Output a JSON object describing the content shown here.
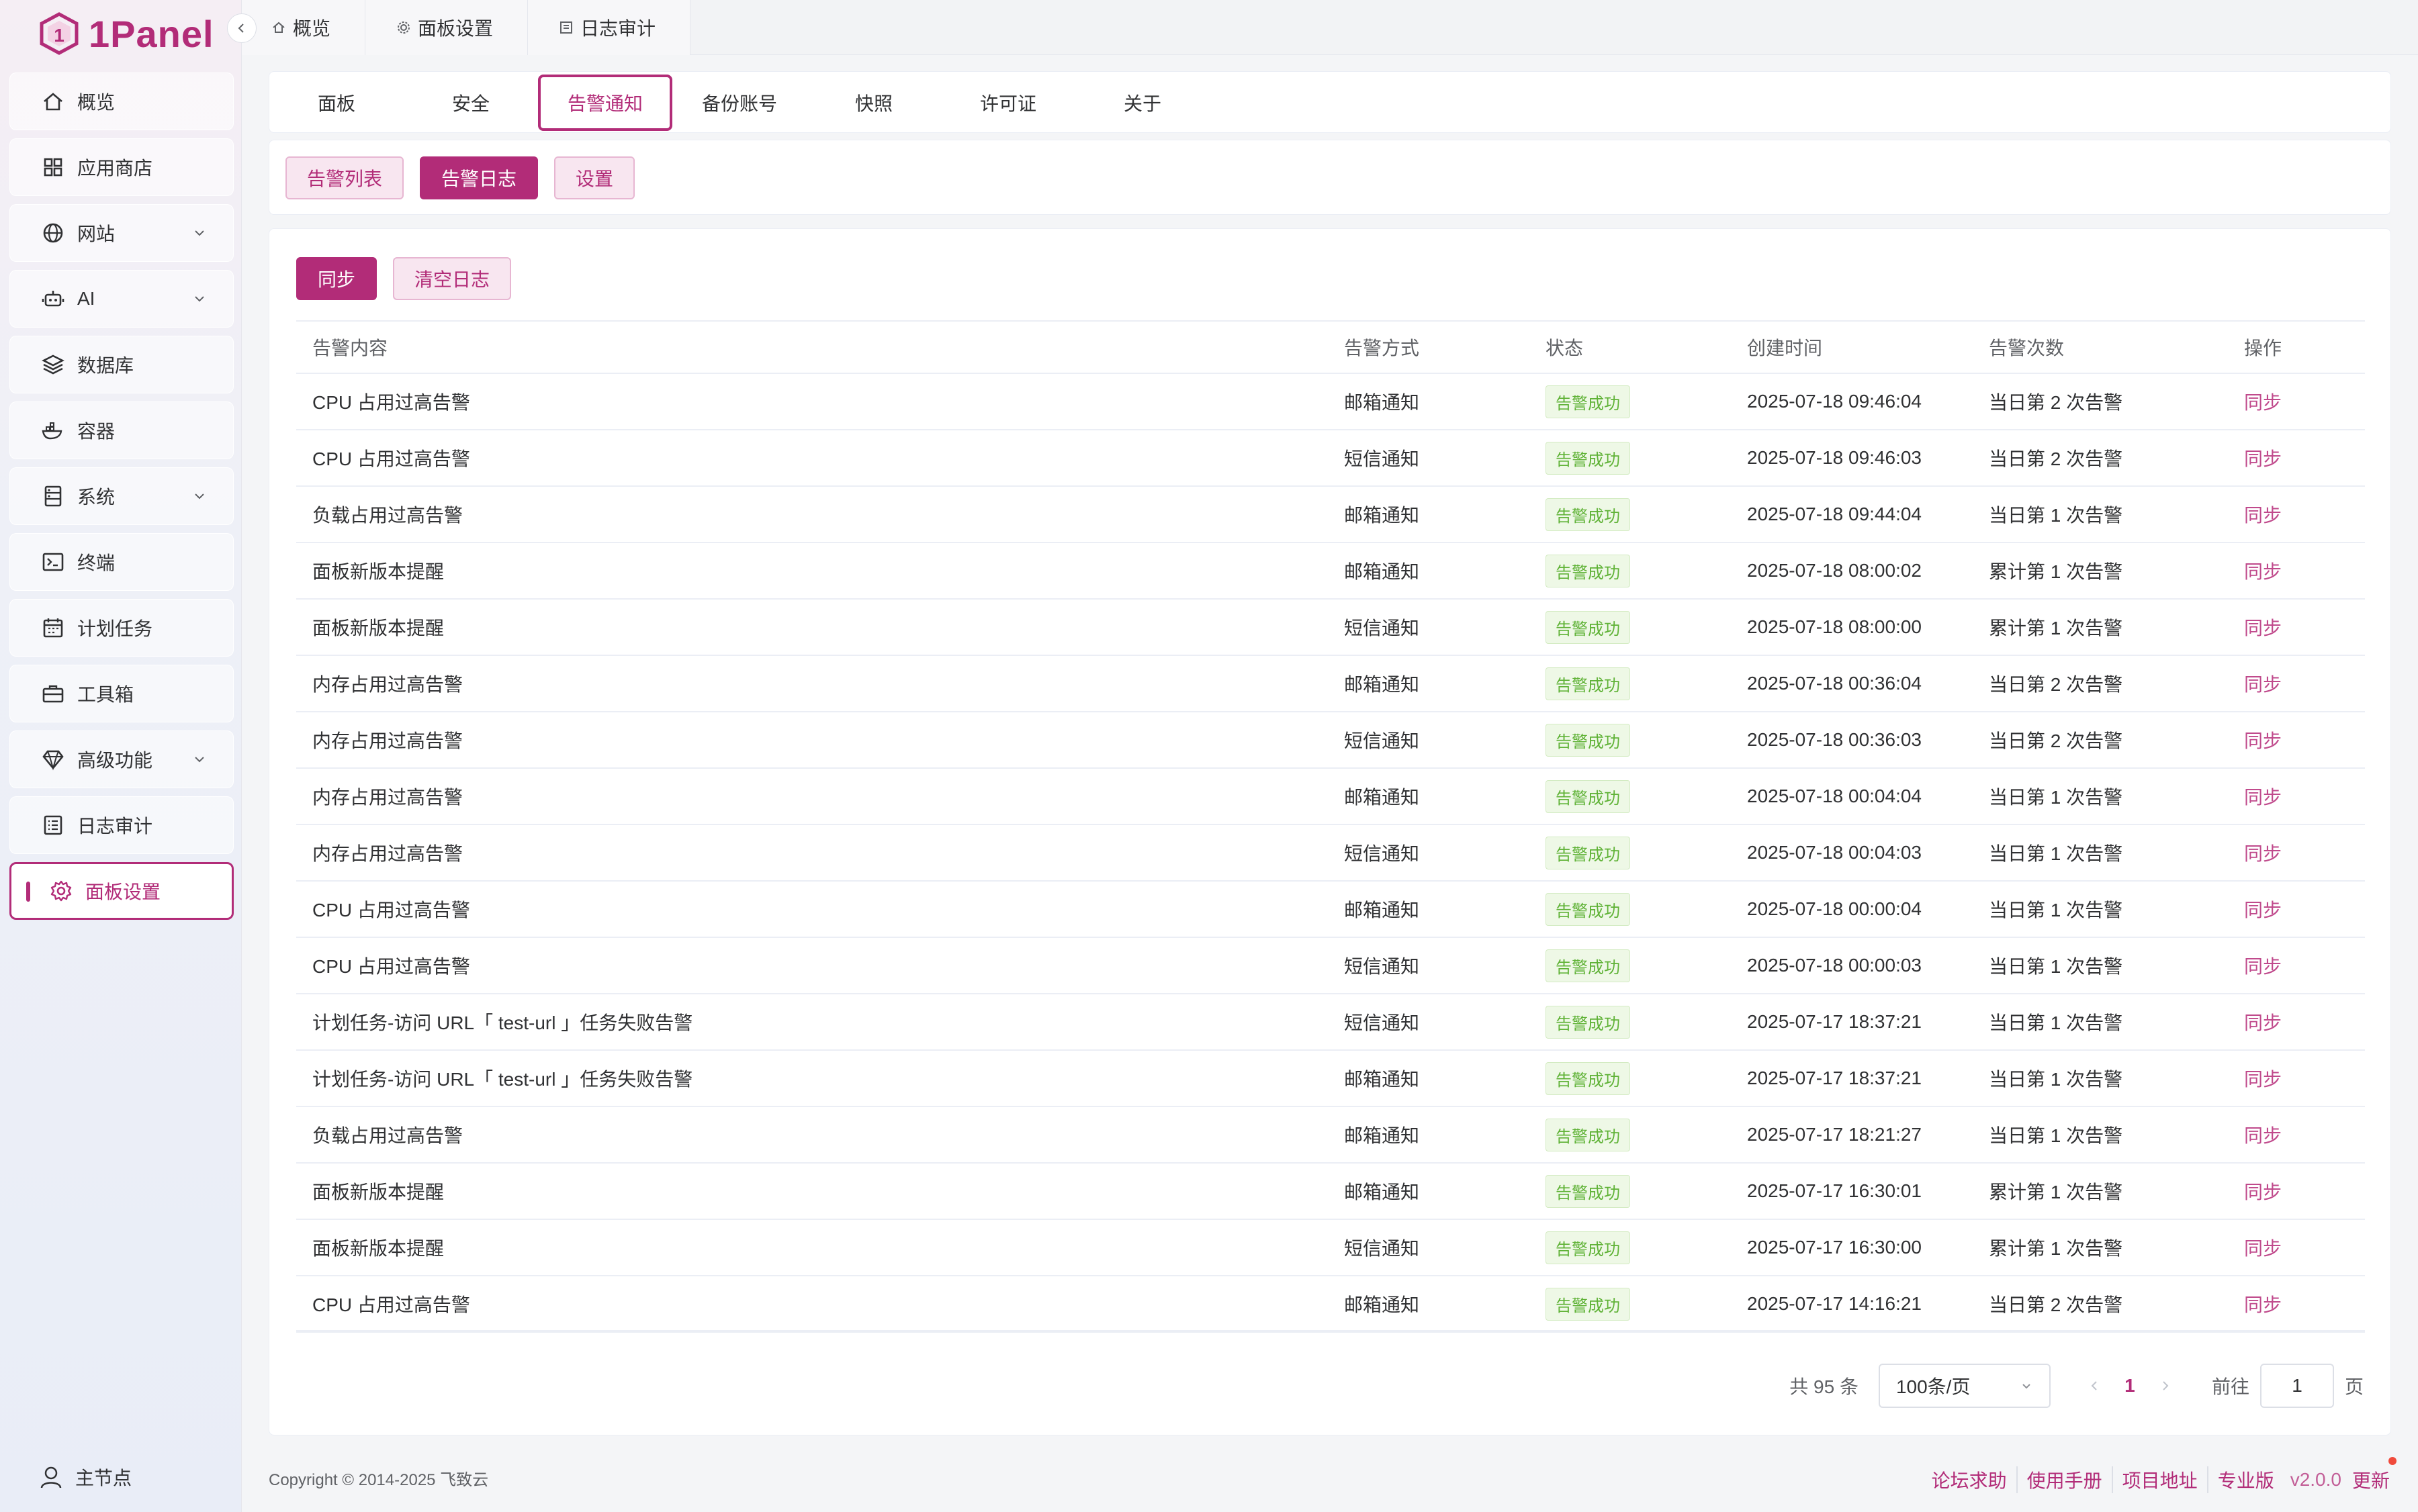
{
  "app": {
    "logo_text": "1Panel",
    "accent": "#b22c78"
  },
  "top_tabs": [
    {
      "label": "概览",
      "icon": "home-icon"
    },
    {
      "label": "面板设置",
      "icon": "gear-icon"
    },
    {
      "label": "日志审计",
      "icon": "list-icon"
    }
  ],
  "sidebar": {
    "items": [
      {
        "label": "概览",
        "icon": "home-icon"
      },
      {
        "label": "应用商店",
        "icon": "grid-icon"
      },
      {
        "label": "网站",
        "icon": "globe-icon",
        "expandable": true
      },
      {
        "label": "AI",
        "icon": "robot-icon",
        "expandable": true
      },
      {
        "label": "数据库",
        "icon": "layers-icon"
      },
      {
        "label": "容器",
        "icon": "docker-icon"
      },
      {
        "label": "系统",
        "icon": "server-icon",
        "expandable": true
      },
      {
        "label": "终端",
        "icon": "terminal-icon"
      },
      {
        "label": "计划任务",
        "icon": "calendar-icon"
      },
      {
        "label": "工具箱",
        "icon": "toolbox-icon"
      },
      {
        "label": "高级功能",
        "icon": "diamond-icon",
        "expandable": true
      },
      {
        "label": "日志审计",
        "icon": "log-icon"
      },
      {
        "label": "面板设置",
        "icon": "gear-icon",
        "active": true
      }
    ],
    "node_label": "主节点"
  },
  "main_tabs": [
    "面板",
    "安全",
    "告警通知",
    "备份账号",
    "快照",
    "许可证",
    "关于"
  ],
  "main_tab_active": "告警通知",
  "sub_tabs": [
    "告警列表",
    "告警日志",
    "设置"
  ],
  "sub_tab_active": "告警日志",
  "actions": {
    "sync": "同步",
    "clear": "清空日志"
  },
  "table": {
    "headers": [
      "告警内容",
      "告警方式",
      "状态",
      "创建时间",
      "告警次数",
      "操作"
    ],
    "rows": [
      [
        "CPU 占用过高告警",
        "邮箱通知",
        "告警成功",
        "2025-07-18 09:46:04",
        "当日第 2 次告警",
        "同步"
      ],
      [
        "CPU 占用过高告警",
        "短信通知",
        "告警成功",
        "2025-07-18 09:46:03",
        "当日第 2 次告警",
        "同步"
      ],
      [
        "负载占用过高告警",
        "邮箱通知",
        "告警成功",
        "2025-07-18 09:44:04",
        "当日第 1 次告警",
        "同步"
      ],
      [
        "面板新版本提醒",
        "邮箱通知",
        "告警成功",
        "2025-07-18 08:00:02",
        "累计第 1 次告警",
        "同步"
      ],
      [
        "面板新版本提醒",
        "短信通知",
        "告警成功",
        "2025-07-18 08:00:00",
        "累计第 1 次告警",
        "同步"
      ],
      [
        "内存占用过高告警",
        "邮箱通知",
        "告警成功",
        "2025-07-18 00:36:04",
        "当日第 2 次告警",
        "同步"
      ],
      [
        "内存占用过高告警",
        "短信通知",
        "告警成功",
        "2025-07-18 00:36:03",
        "当日第 2 次告警",
        "同步"
      ],
      [
        "内存占用过高告警",
        "邮箱通知",
        "告警成功",
        "2025-07-18 00:04:04",
        "当日第 1 次告警",
        "同步"
      ],
      [
        "内存占用过高告警",
        "短信通知",
        "告警成功",
        "2025-07-18 00:04:03",
        "当日第 1 次告警",
        "同步"
      ],
      [
        "CPU 占用过高告警",
        "邮箱通知",
        "告警成功",
        "2025-07-18 00:00:04",
        "当日第 1 次告警",
        "同步"
      ],
      [
        "CPU 占用过高告警",
        "短信通知",
        "告警成功",
        "2025-07-18 00:00:03",
        "当日第 1 次告警",
        "同步"
      ],
      [
        "计划任务-访问 URL「 test-url 」任务失败告警",
        "短信通知",
        "告警成功",
        "2025-07-17 18:37:21",
        "当日第 1 次告警",
        "同步"
      ],
      [
        "计划任务-访问 URL「 test-url 」任务失败告警",
        "邮箱通知",
        "告警成功",
        "2025-07-17 18:37:21",
        "当日第 1 次告警",
        "同步"
      ],
      [
        "负载占用过高告警",
        "邮箱通知",
        "告警成功",
        "2025-07-17 18:21:27",
        "当日第 1 次告警",
        "同步"
      ],
      [
        "面板新版本提醒",
        "邮箱通知",
        "告警成功",
        "2025-07-17 16:30:01",
        "累计第 1 次告警",
        "同步"
      ],
      [
        "面板新版本提醒",
        "短信通知",
        "告警成功",
        "2025-07-17 16:30:00",
        "累计第 1 次告警",
        "同步"
      ],
      [
        "CPU 占用过高告警",
        "邮箱通知",
        "告警成功",
        "2025-07-17 14:16:21",
        "当日第 2 次告警",
        "同步"
      ]
    ]
  },
  "pagination": {
    "total": "共 95 条",
    "page_size": "100条/页",
    "current_page": "1",
    "goto_label": "前往",
    "goto_value": "1",
    "page_suffix": "页"
  },
  "footer": {
    "copyright": "Copyright © 2014-2025 飞致云",
    "links": [
      "论坛求助",
      "使用手册",
      "项目地址",
      "专业版"
    ],
    "version": "v2.0.0",
    "update": "更新"
  }
}
